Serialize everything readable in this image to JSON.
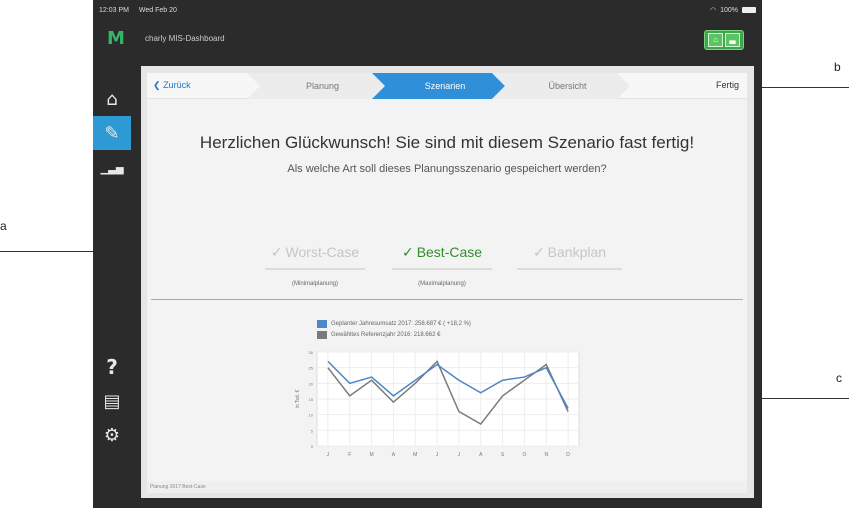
{
  "status_bar": {
    "time": "12:03 PM",
    "date": "Wed Feb 20",
    "battery": "100%"
  },
  "app": {
    "title": "charly MIS-Dashboard",
    "logo": "M"
  },
  "sidebar": {
    "items": [
      {
        "icon": "home-icon",
        "glyph": "⌂"
      },
      {
        "icon": "planning-icon",
        "glyph": "✎"
      },
      {
        "icon": "bar-chart-icon",
        "glyph": "▁▃▅"
      }
    ],
    "bottom_items": [
      {
        "icon": "help-icon",
        "glyph": "?"
      },
      {
        "icon": "message-icon",
        "glyph": "▤"
      },
      {
        "icon": "settings-icon",
        "glyph": "⚙"
      }
    ]
  },
  "stepper": {
    "back_label": "Zurück",
    "steps": [
      "Planung",
      "Szenarien",
      "Übersicht"
    ],
    "active_index": 1,
    "done_label": "Fertig"
  },
  "main": {
    "heading": "Herzlichen Glückwunsch! Sie sind mit diesem Szenario fast fertig!",
    "subheading": "Als welche Art soll dieses Planungsszenario gespeichert werden?",
    "options": [
      {
        "label": "Worst-Case",
        "sub": "(Minimalplanung)",
        "selected": false
      },
      {
        "label": "Best-Case",
        "sub": "(Maximalplanung)",
        "selected": true
      },
      {
        "label": "Bankplan",
        "sub": "",
        "selected": false
      }
    ],
    "footer": "Planung 2017 Best-Case"
  },
  "chart_data": {
    "type": "line",
    "categories": [
      "J",
      "F",
      "M",
      "A",
      "M",
      "J",
      "J",
      "A",
      "S",
      "O",
      "N",
      "D"
    ],
    "ylabel": "in Tsd. €",
    "ylim": [
      0,
      30
    ],
    "yticks": [
      0,
      5,
      10,
      15,
      20,
      25,
      30
    ],
    "grid": true,
    "legend_position": "top",
    "series": [
      {
        "name": "Geplanter Jahresumsatz 2017: 258.687 € ( +18,2 %)",
        "color": "#4f86c6",
        "values": [
          27,
          20,
          22,
          16,
          21,
          26,
          21,
          17,
          21,
          22,
          25,
          12
        ]
      },
      {
        "name": "Gewähltes Referenzjahr 2016: 218.662 €",
        "color": "#7a7a7a",
        "values": [
          25,
          16,
          21,
          14,
          20,
          27,
          11,
          7,
          16,
          21,
          26,
          11
        ]
      }
    ]
  },
  "callouts": {
    "a": "a",
    "b": "b",
    "c": "c"
  }
}
